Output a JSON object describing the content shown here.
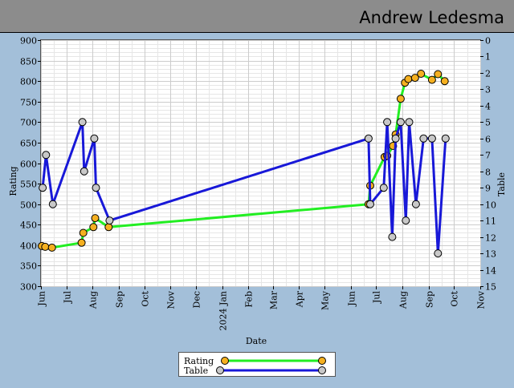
{
  "header": {
    "name": "Andrew Ledesma"
  },
  "chart_data": {
    "type": "line",
    "xlabel": "Date",
    "ylabel_left": "Rating",
    "ylabel_right": "Table",
    "y_left_range": [
      300,
      900
    ],
    "y_left_ticks": [
      300,
      350,
      400,
      450,
      500,
      550,
      600,
      650,
      700,
      750,
      800,
      850,
      900
    ],
    "y_right_range": [
      15,
      0
    ],
    "y_right_ticks": [
      0,
      1,
      2,
      3,
      4,
      5,
      6,
      7,
      8,
      9,
      10,
      11,
      12,
      13,
      14,
      15
    ],
    "x_range": [
      "2023-06-01",
      "2024-11-01"
    ],
    "x_ticks": [
      {
        "date": "2023-06-01",
        "label": "Jun"
      },
      {
        "date": "2023-07-01",
        "label": "Jul"
      },
      {
        "date": "2023-08-01",
        "label": "Aug"
      },
      {
        "date": "2023-09-01",
        "label": "Sep"
      },
      {
        "date": "2023-10-01",
        "label": "Oct"
      },
      {
        "date": "2023-11-01",
        "label": "Nov"
      },
      {
        "date": "2023-12-01",
        "label": "Dec"
      },
      {
        "date": "2024-01-01",
        "label": "2024 Jan"
      },
      {
        "date": "2024-02-01",
        "label": "Feb"
      },
      {
        "date": "2024-03-01",
        "label": "Mar"
      },
      {
        "date": "2024-04-01",
        "label": "Apr"
      },
      {
        "date": "2024-05-01",
        "label": "May"
      },
      {
        "date": "2024-06-01",
        "label": "Jun"
      },
      {
        "date": "2024-07-01",
        "label": "Jul"
      },
      {
        "date": "2024-08-01",
        "label": "Aug"
      },
      {
        "date": "2024-09-01",
        "label": "Sep"
      },
      {
        "date": "2024-10-01",
        "label": "Oct"
      },
      {
        "date": "2024-11-01",
        "label": "Nov"
      }
    ],
    "grid": true,
    "legend_position": "bottom-center",
    "series": [
      {
        "name": "Rating",
        "axis": "left",
        "line_color": "#22ee22",
        "marker_color": "#f5b020",
        "points": [
          {
            "x": "2023-06-02",
            "y": 398
          },
          {
            "x": "2023-06-06",
            "y": 396
          },
          {
            "x": "2023-06-14",
            "y": 394
          },
          {
            "x": "2023-07-19",
            "y": 406
          },
          {
            "x": "2023-07-21",
            "y": 430
          },
          {
            "x": "2023-08-02",
            "y": 444
          },
          {
            "x": "2023-08-04",
            "y": 466
          },
          {
            "x": "2023-08-20",
            "y": 444
          },
          {
            "x": "2024-06-22",
            "y": 500
          },
          {
            "x": "2024-06-24",
            "y": 545
          },
          {
            "x": "2024-07-11",
            "y": 615
          },
          {
            "x": "2024-07-14",
            "y": 618
          },
          {
            "x": "2024-07-21",
            "y": 642
          },
          {
            "x": "2024-07-24",
            "y": 670
          },
          {
            "x": "2024-07-30",
            "y": 757
          },
          {
            "x": "2024-08-04",
            "y": 796
          },
          {
            "x": "2024-08-08",
            "y": 805
          },
          {
            "x": "2024-08-16",
            "y": 808
          },
          {
            "x": "2024-08-23",
            "y": 818
          },
          {
            "x": "2024-09-05",
            "y": 803
          },
          {
            "x": "2024-09-12",
            "y": 817
          },
          {
            "x": "2024-09-20",
            "y": 800
          }
        ]
      },
      {
        "name": "Table",
        "axis": "right",
        "line_color": "#1818d8",
        "marker_color": "#c8c8c8",
        "points": [
          {
            "x": "2023-06-03",
            "y": 9
          },
          {
            "x": "2023-06-07",
            "y": 7
          },
          {
            "x": "2023-06-15",
            "y": 10
          },
          {
            "x": "2023-07-20",
            "y": 5
          },
          {
            "x": "2023-07-22",
            "y": 8
          },
          {
            "x": "2023-08-03",
            "y": 6
          },
          {
            "x": "2023-08-05",
            "y": 9
          },
          {
            "x": "2023-08-21",
            "y": 11
          },
          {
            "x": "2024-06-22",
            "y": 6
          },
          {
            "x": "2024-06-24",
            "y": 10
          },
          {
            "x": "2024-07-10",
            "y": 9
          },
          {
            "x": "2024-07-14",
            "y": 5
          },
          {
            "x": "2024-07-20",
            "y": 12
          },
          {
            "x": "2024-07-24",
            "y": 6
          },
          {
            "x": "2024-07-30",
            "y": 5
          },
          {
            "x": "2024-08-05",
            "y": 11
          },
          {
            "x": "2024-08-09",
            "y": 5
          },
          {
            "x": "2024-08-17",
            "y": 10
          },
          {
            "x": "2024-08-26",
            "y": 6
          },
          {
            "x": "2024-09-05",
            "y": 6
          },
          {
            "x": "2024-09-12",
            "y": 13
          },
          {
            "x": "2024-09-21",
            "y": 6
          }
        ]
      }
    ]
  }
}
